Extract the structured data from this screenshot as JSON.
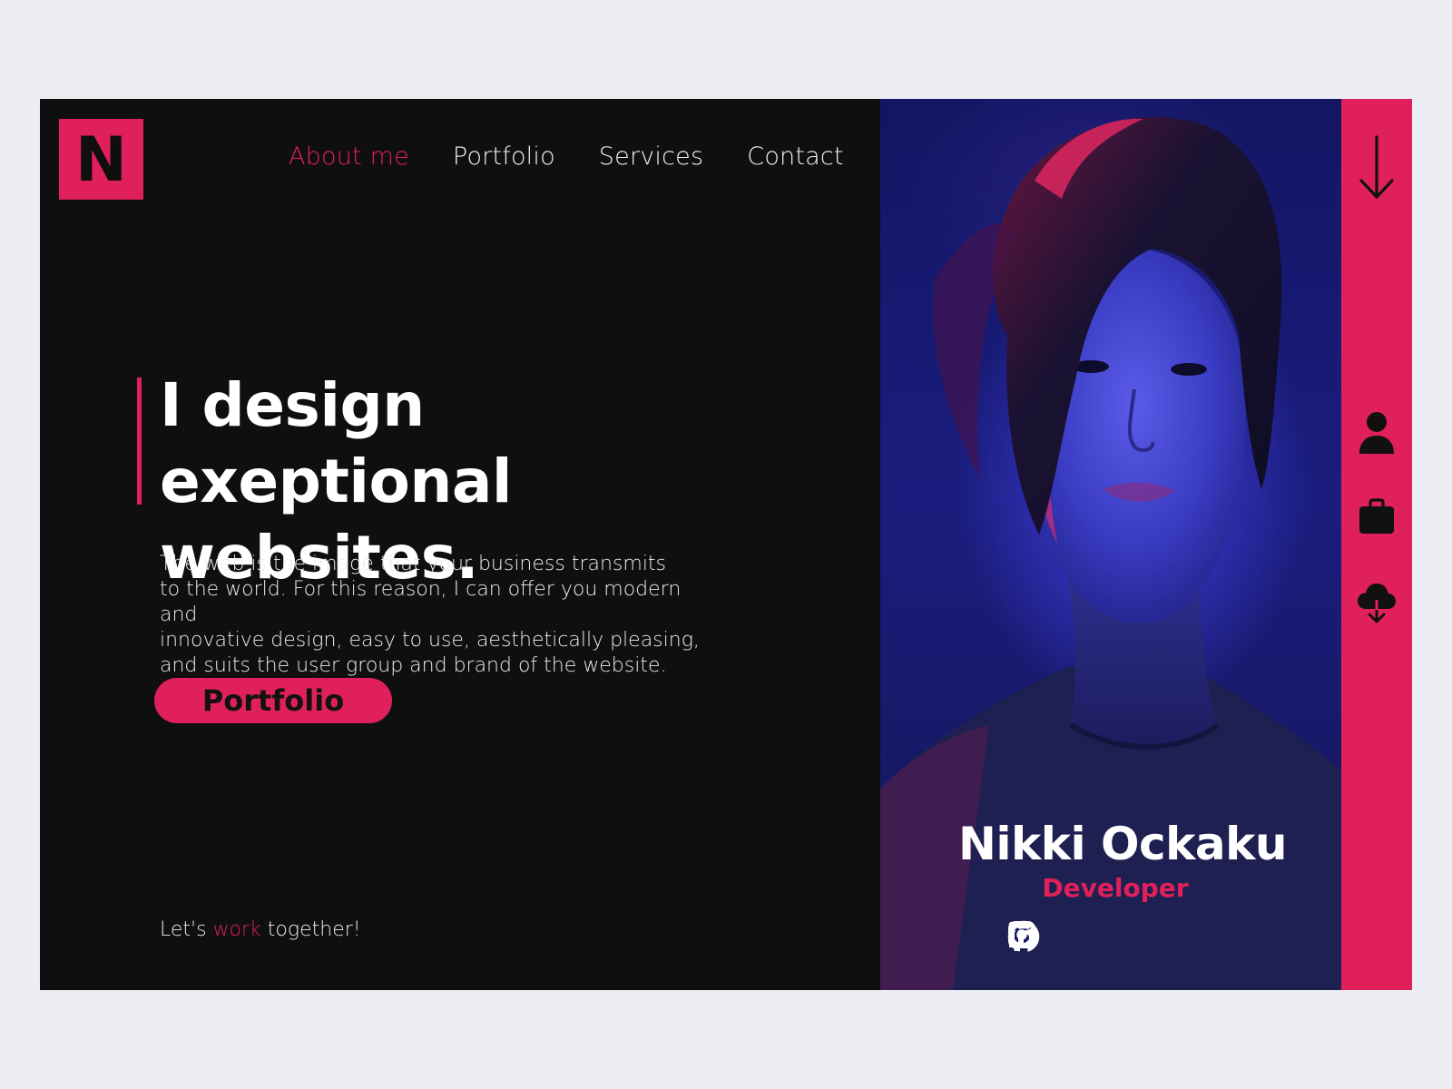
{
  "brand": {
    "logo_letter": "N"
  },
  "nav": {
    "items": [
      {
        "label": "About me",
        "active": true
      },
      {
        "label": "Portfolio",
        "active": false
      },
      {
        "label": "Services",
        "active": false
      },
      {
        "label": "Contact",
        "active": false
      }
    ]
  },
  "hero": {
    "title_line1": "I design exeptional",
    "title_line2": "websites.",
    "desc_line1": "The web is the image that your business transmits",
    "desc_line2": "to the world. For this reason, I can offer you modern and",
    "desc_line3": "innovative design, easy to use, aesthetically pleasing,",
    "desc_line4": "and suits the user group and brand of the website.",
    "cta_label": "Portfolio",
    "tagline_pre": "Let's",
    "tagline_highlight": "work",
    "tagline_post": "together!"
  },
  "profile": {
    "name": "Nikki Ockaku",
    "role": "Developer",
    "socials": [
      "facebook-icon",
      "instagram-icon",
      "github-icon",
      "linkedin-icon"
    ]
  },
  "rail": {
    "icons": [
      "arrow-down-icon",
      "user-icon",
      "briefcase-icon",
      "cloud-download-icon"
    ]
  },
  "colors": {
    "accent": "#e0205a",
    "background": "#0f0f10",
    "page": "#eceef3"
  }
}
